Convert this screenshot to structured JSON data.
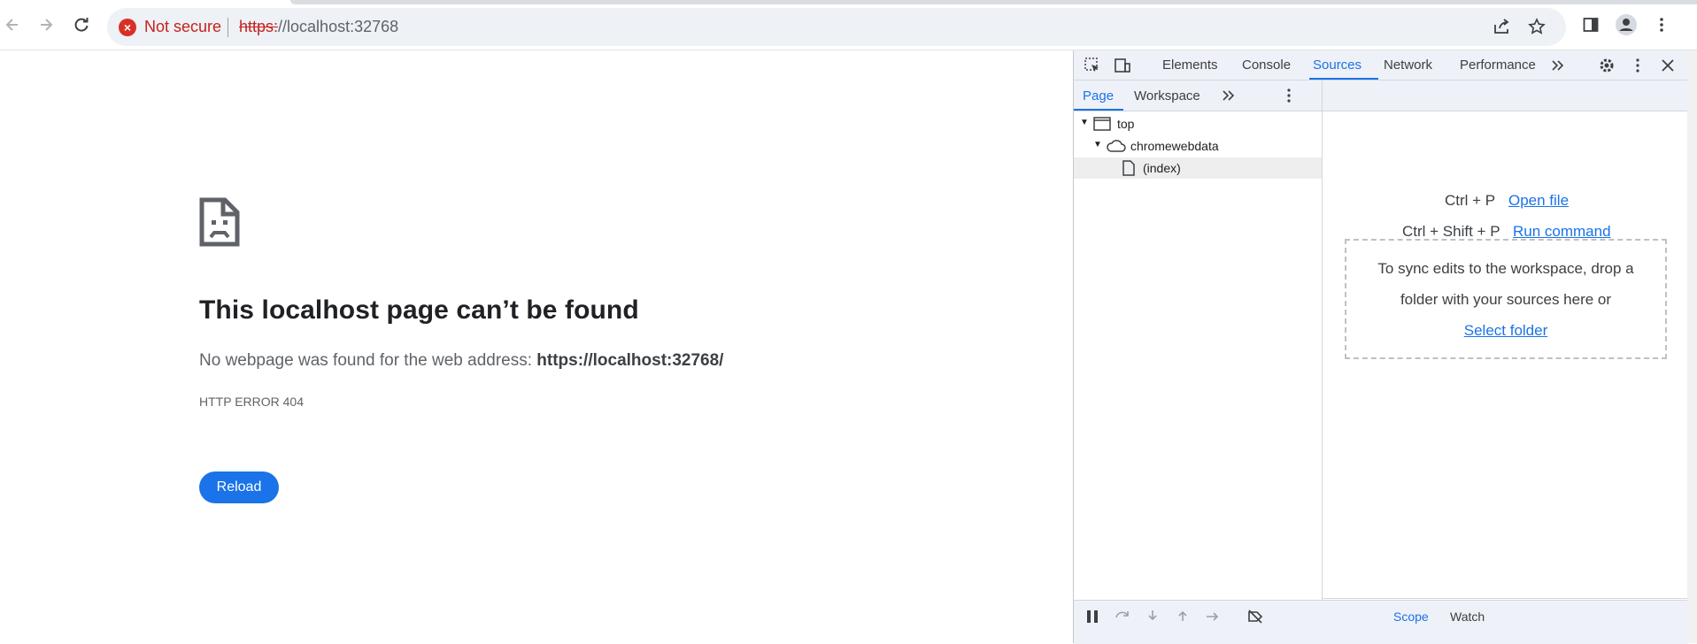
{
  "browser": {
    "security_label": "Not secure",
    "url_scheme": "https:",
    "url_rest": "//localhost:32768",
    "icons": [
      "back-icon",
      "forward-icon",
      "reload-icon",
      "share-icon",
      "star-icon",
      "side-panel-icon",
      "profile-icon",
      "menu-icon"
    ]
  },
  "error_page": {
    "title": "This localhost page can’t be found",
    "description_prefix": "No webpage was found for the web address:",
    "description_url": "https://localhost:32768/",
    "code": "HTTP ERROR 404",
    "reload_label": "Reload"
  },
  "devtools": {
    "tabs": [
      "Elements",
      "Console",
      "Sources",
      "Network",
      "Performance"
    ],
    "active_tab": "Sources",
    "nav_tabs": [
      "Page",
      "Workspace"
    ],
    "active_nav_tab": "Page",
    "tree": [
      {
        "label": "top",
        "icon": "frame-icon"
      },
      {
        "label": "chromewebdata",
        "icon": "cloud-icon"
      },
      {
        "label": "(index)",
        "icon": "file-icon",
        "selected": true
      }
    ],
    "shortcuts": [
      {
        "keys": "Ctrl + P",
        "action": "Open file"
      },
      {
        "keys": "Ctrl + Shift + P",
        "action": "Run command"
      }
    ],
    "drop_zone_text": "To sync edits to the workspace, drop a folder with your sources here or",
    "drop_zone_link": "Select folder",
    "debug_tabs": [
      "Scope",
      "Watch"
    ]
  },
  "colors": {
    "accent": "#1a73e8",
    "insecure": "#c5221f",
    "toolbar_bg": "#eef1f8"
  }
}
